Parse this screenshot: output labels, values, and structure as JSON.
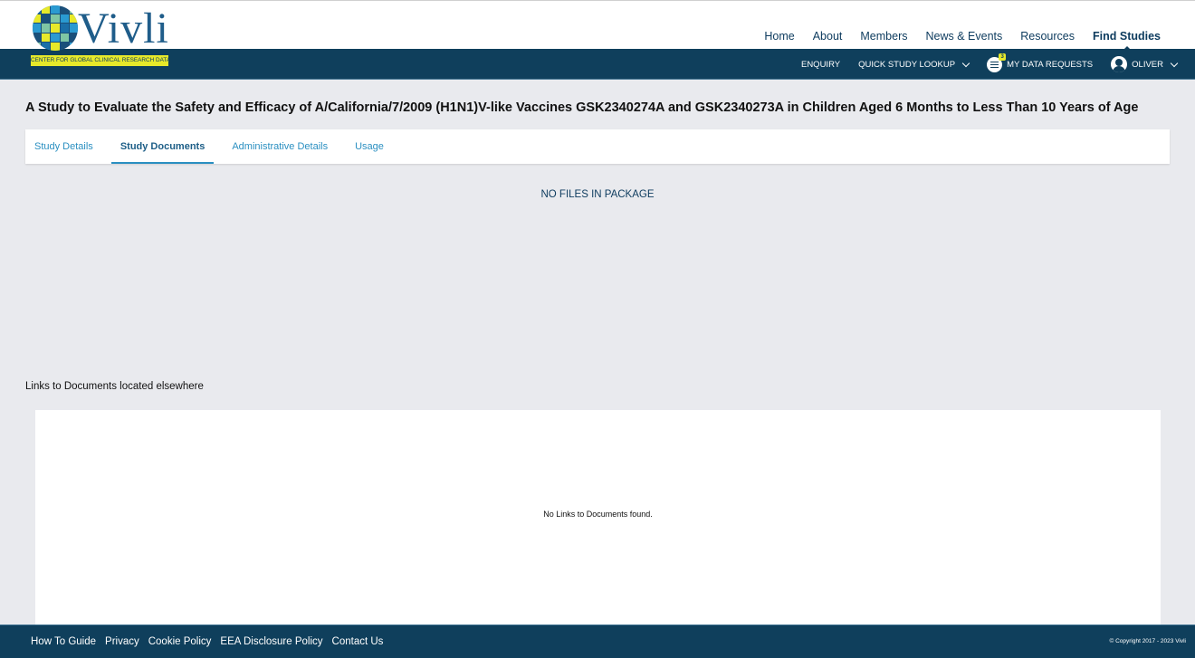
{
  "brand": {
    "name": "Vivli",
    "tagline": "CENTER FOR GLOBAL CLINICAL RESEARCH DATA",
    "colors": {
      "primary": "#0f3f5c",
      "accent": "#e7e92a",
      "link": "#2a8fc1"
    }
  },
  "main_nav": {
    "items": [
      {
        "label": "Home"
      },
      {
        "label": "About"
      },
      {
        "label": "Members"
      },
      {
        "label": "News & Events"
      },
      {
        "label": "Resources"
      },
      {
        "label": "Find Studies"
      }
    ],
    "active": "Find Studies"
  },
  "sub_nav": {
    "enquiry": "ENQUIRY",
    "quick_lookup": "QUICK STUDY LOOKUP",
    "data_requests": "MY DATA REQUESTS",
    "data_requests_badge": "3",
    "user": "OLIVER",
    "icons": {
      "requests": "list-icon",
      "user": "user-icon",
      "dropdown": "chevron-down-icon"
    }
  },
  "page": {
    "title": "A Study to Evaluate the Safety and Efficacy of A/California/7/2009 (H1N1)V-like Vaccines GSK2340274A and GSK2340273A in Children Aged 6 Months to Less Than 10 Years of Age"
  },
  "tabs": [
    {
      "label": "Study Details"
    },
    {
      "label": "Study Documents"
    },
    {
      "label": "Administrative Details"
    },
    {
      "label": "Usage"
    }
  ],
  "active_tab": "Study Documents",
  "documents": {
    "empty_message": "NO FILES IN PACKAGE"
  },
  "links": {
    "heading": "Links to Documents located elsewhere",
    "empty_message": "No Links to Documents found."
  },
  "footer": {
    "links": [
      {
        "label": "How To Guide"
      },
      {
        "label": "Privacy"
      },
      {
        "label": "Cookie Policy"
      },
      {
        "label": "EEA Disclosure Policy"
      },
      {
        "label": "Contact Us"
      }
    ],
    "copyright": "© Copyright 2017 - 2023 Vivli"
  }
}
